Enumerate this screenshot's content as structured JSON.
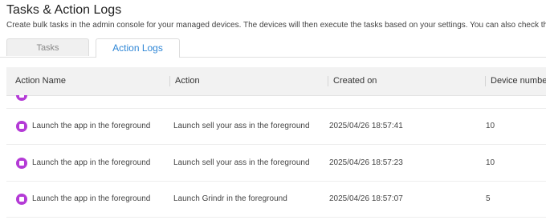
{
  "header": {
    "title": "Tasks & Action Logs",
    "description": "Create bulk tasks in the admin console for your managed devices. The devices will then execute the tasks based on your settings. You can also check the results of bulk actio"
  },
  "tabs": [
    {
      "label": "Tasks",
      "active": false
    },
    {
      "label": "Action Logs",
      "active": true
    }
  ],
  "table": {
    "columns": [
      "Action Name",
      "Action",
      "Created on",
      "Device number"
    ],
    "rows": [
      {
        "action_name": "Launch the app in the foreground",
        "action": "Launch sell your ass in the foreground",
        "created_on": "2025/04/26 18:57:41",
        "device_number": "10"
      },
      {
        "action_name": "Launch the app in the foreground",
        "action": "Launch sell your ass in the foreground",
        "created_on": "2025/04/26 18:57:23",
        "device_number": "10"
      },
      {
        "action_name": "Launch the app in the foreground",
        "action": "Launch Grindr in the foreground",
        "created_on": "2025/04/26 18:57:07",
        "device_number": "5"
      }
    ]
  },
  "colors": {
    "accent": "#2e86d6",
    "app_icon": "#b43bd6",
    "header_bg": "#f2f2f2"
  },
  "icons": {
    "row_app_icon": "app-icon",
    "row_chevron": "chevron-right-icon"
  }
}
